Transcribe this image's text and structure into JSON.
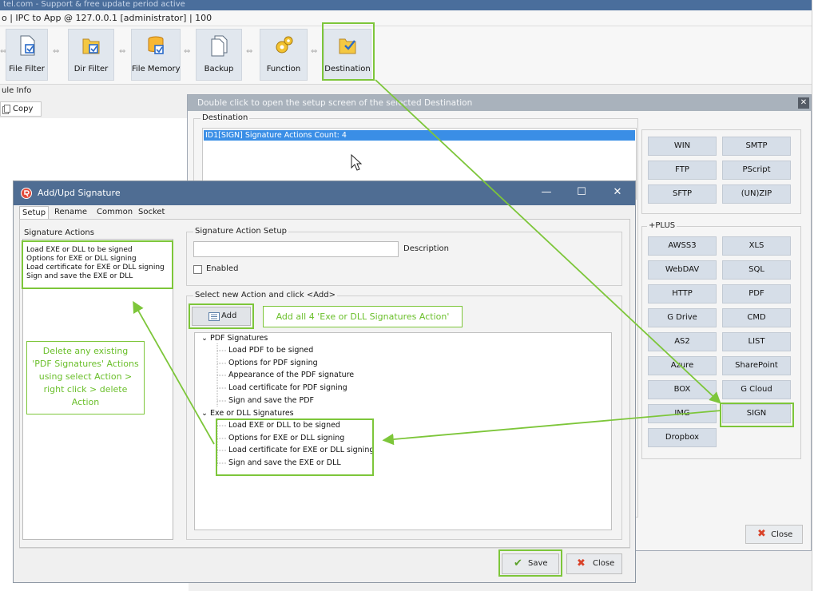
{
  "app": {
    "top_strip": "tel.com - Support & free update period active",
    "breadcrumb": "o  |  IPC to App @ 127.0.0.1 [administrator]  |  100",
    "module_info": "ule Info",
    "copy_button": "Copy"
  },
  "ribbon": {
    "buttons": [
      {
        "label": "File Filter",
        "icon": "file-filter-icon"
      },
      {
        "label": "Dir Filter",
        "icon": "dir-filter-icon"
      },
      {
        "label": "File Memory",
        "icon": "file-memory-icon"
      },
      {
        "label": "Backup",
        "icon": "backup-icon"
      },
      {
        "label": "Function",
        "icon": "function-gear-icon"
      },
      {
        "label": "Destination",
        "icon": "destination-icon"
      }
    ]
  },
  "destination_dialog": {
    "title": "Double click to open the setup screen of the selected Destination",
    "group_label": "Destination",
    "selected_item": "ID1[SIGN] Signature Actions Count: 4",
    "buttons_top": [
      "WIN",
      "SMTP",
      "FTP",
      "PScript",
      "SFTP",
      "(UN)ZIP"
    ],
    "plus_label": "+PLUS",
    "buttons_plus": [
      "AWSS3",
      "XLS",
      "WebDAV",
      "SQL",
      "HTTP",
      "PDF",
      "G Drive",
      "CMD",
      "AS2",
      "LIST",
      "Azure",
      "SharePoint",
      "BOX",
      "G Cloud",
      "IMG",
      "SIGN",
      "Dropbox"
    ],
    "close_label": "Close"
  },
  "signature_dialog": {
    "title": "Add/Upd Signature",
    "tabs": [
      "Setup",
      "Rename",
      "Common",
      "Socket"
    ],
    "actions_label": "Signature Actions",
    "actions": [
      "Load EXE or DLL to be signed",
      "Options for EXE or DLL signing",
      "Load certificate for EXE or DLL signing",
      "Sign and save the EXE or DLL"
    ],
    "setup_group_label": "Signature Action Setup",
    "description_label": "Description",
    "description_value": "",
    "enabled_label": "Enabled",
    "select_group_label": "Select new Action  and click <Add>",
    "add_label": "Add",
    "tree": {
      "pdf_group": "PDF Signatures",
      "pdf_items": [
        "Load PDF to be signed",
        "Options for PDF signing",
        "Appearance of the PDF signature",
        "Load certificate for PDF signing",
        "Sign and save the PDF"
      ],
      "exe_group": "Exe or DLL Signatures",
      "exe_items": [
        "Load EXE or DLL to be signed",
        "Options for EXE or DLL signing",
        "Load certificate for EXE or DLL signing",
        "Sign and save the EXE or DLL"
      ]
    },
    "save_label": "Save",
    "close_label": "Close"
  },
  "annotations": {
    "add_note": "Add all 4 'Exe or DLL Signatures Action'",
    "delete_note": "Delete any existing 'PDF Signatures' Actions using select Action > right click > delete Action"
  },
  "colors": {
    "accent_green": "#7dc63a",
    "selection_blue": "#3a8ee6",
    "title_bar": "#4f6d93"
  }
}
